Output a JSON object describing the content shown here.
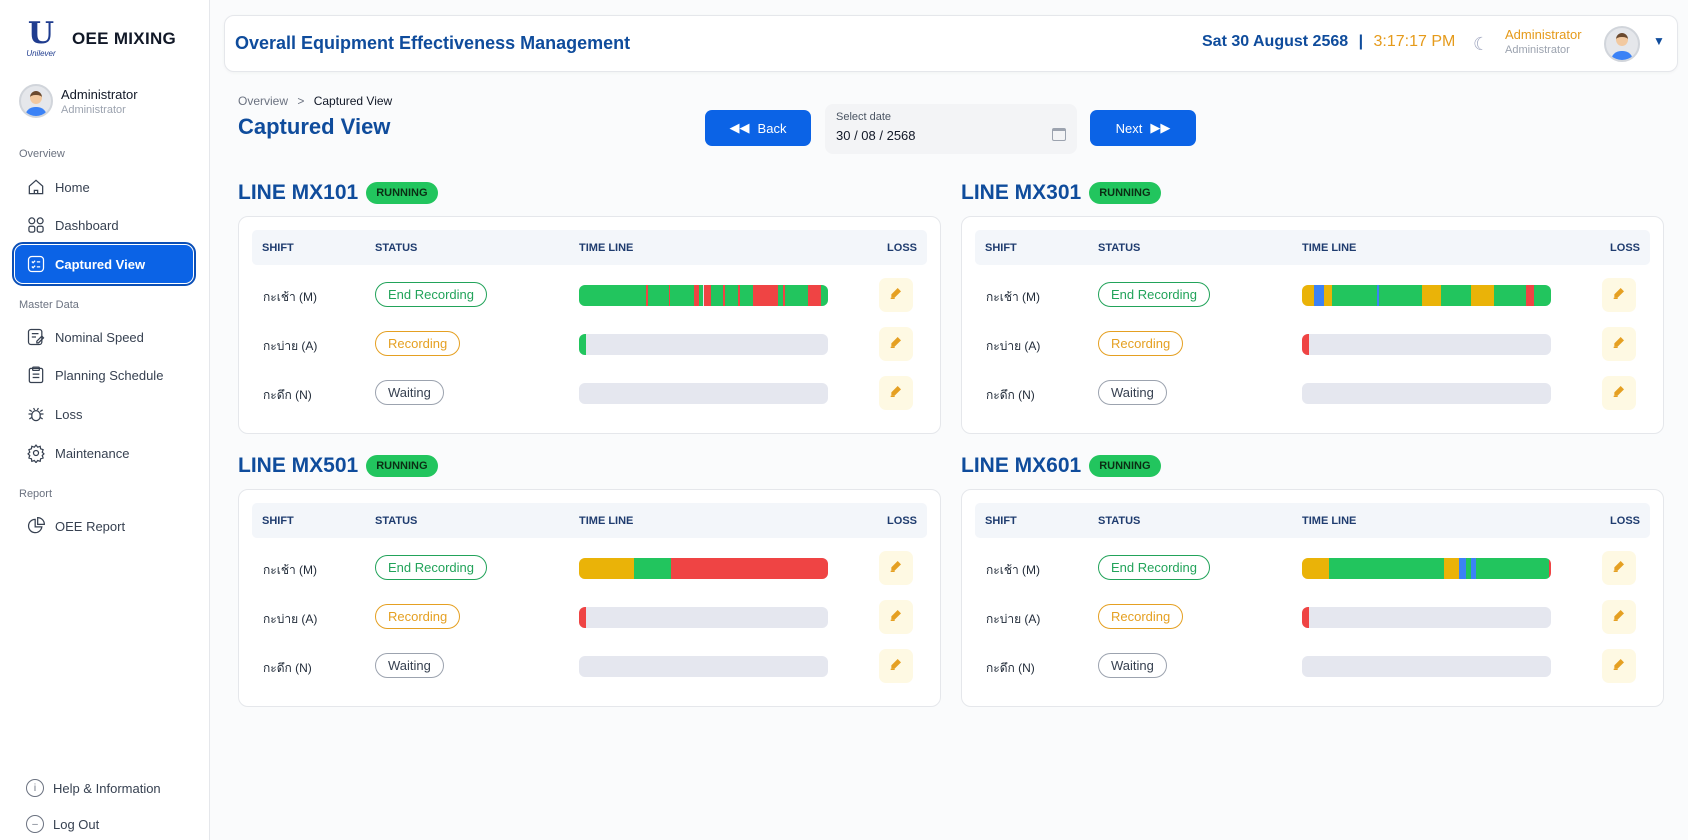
{
  "brand": {
    "logo_text": "Unilever",
    "name": "OEE MIXING"
  },
  "sidebar_user": {
    "name": "Administrator",
    "role": "Administrator"
  },
  "nav": {
    "overview_label": "Overview",
    "home": "Home",
    "dashboard": "Dashboard",
    "captured_view": "Captured View",
    "master_label": "Master Data",
    "nominal_speed": "Nominal Speed",
    "planning_schedule": "Planning Schedule",
    "loss": "Loss",
    "maintenance": "Maintenance",
    "report_label": "Report",
    "oee_report": "OEE Report",
    "help": "Help & Information",
    "logout": "Log Out"
  },
  "header": {
    "title": "Overall Equipment Effectiveness Management",
    "date": "Sat 30 August 2568",
    "separator": "|",
    "time": "3:17:17 PM",
    "user_name": "Administrator",
    "user_role": "Administrator"
  },
  "breadcrumb": {
    "parent": "Overview",
    "sep": ">",
    "current": "Captured View"
  },
  "page_title": "Captured View",
  "controls": {
    "back_label": "Back",
    "next_label": "Next",
    "date_label": "Select date",
    "date_value": "30 / 08 / 2568"
  },
  "table_headers": {
    "shift": "SHIFT",
    "status": "STATUS",
    "timeline": "TIME LINE",
    "loss": "LOSS"
  },
  "colors": {
    "run": "#22c55e",
    "stop": "#ef4444",
    "idle": "#eab308",
    "blue": "#3b82f6",
    "track": "#e5e7ef"
  },
  "lines": [
    {
      "name": "LINE MX101",
      "badge": "RUNNING",
      "rows": [
        {
          "shift": "กะเช้า (M)",
          "status": "End Recording",
          "kind": "end",
          "timeline": [
            [
              "g",
              0,
              27
            ],
            [
              "r",
              27,
              27.6
            ],
            [
              "g",
              27.6,
              36
            ],
            [
              "r",
              36,
              36.7
            ],
            [
              "g",
              36.7,
              46
            ],
            [
              "r",
              46,
              48
            ],
            [
              "g",
              48,
              50
            ],
            [
              "r",
              50,
              53
            ],
            [
              "g",
              53,
              58
            ],
            [
              "r",
              58,
              58.6
            ],
            [
              "g",
              58.6,
              64
            ],
            [
              "r",
              64,
              64.6
            ],
            [
              "g",
              64.6,
              70
            ],
            [
              "r",
              70,
              80
            ],
            [
              "g",
              80,
              82
            ],
            [
              "r",
              82,
              82.6
            ],
            [
              "g",
              82.6,
              92
            ],
            [
              "r",
              92,
              97
            ],
            [
              "g",
              97,
              100
            ]
          ]
        },
        {
          "shift": "กะบ่าย (A)",
          "status": "Recording",
          "kind": "rec",
          "timeline": [
            [
              "g",
              0,
              3
            ]
          ]
        },
        {
          "shift": "กะดึก (N)",
          "status": "Waiting",
          "kind": "wait",
          "timeline": []
        }
      ]
    },
    {
      "name": "LINE MX301",
      "badge": "RUNNING",
      "rows": [
        {
          "shift": "กะเช้า (M)",
          "status": "End Recording",
          "kind": "end",
          "timeline": [
            [
              "y",
              0,
              5
            ],
            [
              "b",
              5,
              9
            ],
            [
              "y",
              9,
              12
            ],
            [
              "g",
              12,
              30
            ],
            [
              "b",
              30,
              31
            ],
            [
              "g",
              31,
              48
            ],
            [
              "y",
              48,
              56
            ],
            [
              "g",
              56,
              68
            ],
            [
              "y",
              68,
              77
            ],
            [
              "g",
              77,
              90
            ],
            [
              "r",
              90,
              93
            ],
            [
              "g",
              93,
              100
            ]
          ]
        },
        {
          "shift": "กะบ่าย (A)",
          "status": "Recording",
          "kind": "rec",
          "timeline": [
            [
              "r",
              0,
              3
            ]
          ]
        },
        {
          "shift": "กะดึก (N)",
          "status": "Waiting",
          "kind": "wait",
          "timeline": []
        }
      ]
    },
    {
      "name": "LINE MX501",
      "badge": "RUNNING",
      "rows": [
        {
          "shift": "กะเช้า (M)",
          "status": "End Recording",
          "kind": "end",
          "timeline": [
            [
              "y",
              0,
              22
            ],
            [
              "g",
              22,
              37
            ],
            [
              "r",
              37,
              100
            ]
          ]
        },
        {
          "shift": "กะบ่าย (A)",
          "status": "Recording",
          "kind": "rec",
          "timeline": [
            [
              "r",
              0,
              3
            ]
          ]
        },
        {
          "shift": "กะดึก (N)",
          "status": "Waiting",
          "kind": "wait",
          "timeline": []
        }
      ]
    },
    {
      "name": "LINE MX601",
      "badge": "RUNNING",
      "rows": [
        {
          "shift": "กะเช้า (M)",
          "status": "End Recording",
          "kind": "end",
          "timeline": [
            [
              "y",
              0,
              11
            ],
            [
              "g",
              11,
              57
            ],
            [
              "y",
              57,
              63
            ],
            [
              "b",
              63,
              66
            ],
            [
              "g",
              66,
              68
            ],
            [
              "b",
              68,
              70
            ],
            [
              "g",
              70,
              99
            ],
            [
              "r",
              99,
              100
            ]
          ]
        },
        {
          "shift": "กะบ่าย (A)",
          "status": "Recording",
          "kind": "rec",
          "timeline": [
            [
              "r",
              0,
              3
            ]
          ]
        },
        {
          "shift": "กะดึก (N)",
          "status": "Waiting",
          "kind": "wait",
          "timeline": []
        }
      ]
    }
  ]
}
